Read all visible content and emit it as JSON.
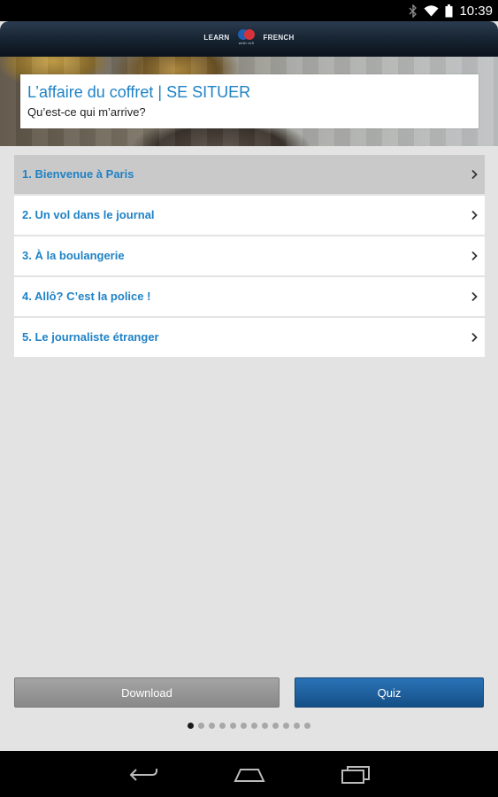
{
  "status_bar": {
    "time": "10:39",
    "icons": [
      "bluetooth-icon",
      "wifi-icon",
      "battery-icon"
    ]
  },
  "header": {
    "logo_left": "LEARN",
    "logo_right": "FRENCH",
    "logo_tagline": "with tv5"
  },
  "hero": {
    "title": "L’affaire du coffret | SE SITUER",
    "subtitle": "Qu’est-ce qui m’arrive?"
  },
  "chapters": [
    {
      "label": "1. Bienvenue à Paris",
      "selected": true
    },
    {
      "label": "2. Un vol dans le journal",
      "selected": false
    },
    {
      "label": "3. À la boulangerie",
      "selected": false
    },
    {
      "label": "4. Allô? C’est la police !",
      "selected": false
    },
    {
      "label": "5. Le journaliste étranger",
      "selected": false
    }
  ],
  "buttons": {
    "download": "Download",
    "quiz": "Quiz"
  },
  "pager": {
    "page": 1,
    "pages": 12
  },
  "nav": {
    "icons": [
      "back-icon",
      "home-icon",
      "recent-apps-icon"
    ]
  },
  "colors": {
    "accent": "#1f82c6",
    "quiz_button": "#1d5f9e",
    "download_button": "#999999",
    "background": "#e3e3e3"
  }
}
